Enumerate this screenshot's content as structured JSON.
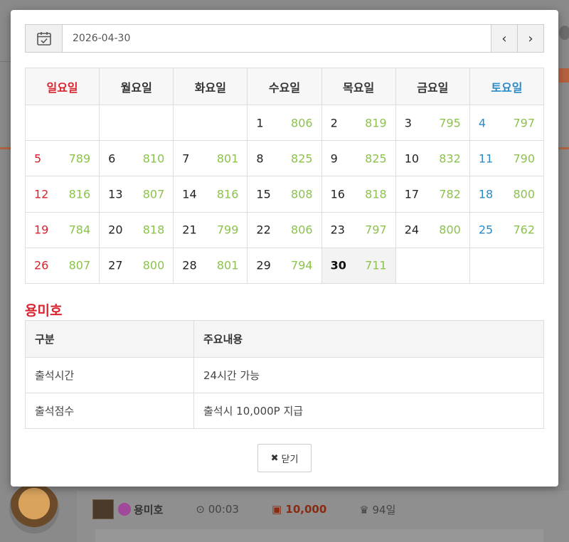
{
  "background": {
    "user_name": "용미호",
    "time": "00:03",
    "points": "10,000",
    "days": "94일"
  },
  "modal": {
    "date_value": "2026-04-30",
    "prev_label": "‹",
    "next_label": "›",
    "weekdays": [
      "일요일",
      "월요일",
      "화요일",
      "수요일",
      "목요일",
      "금요일",
      "토요일"
    ],
    "weeks": [
      [
        null,
        null,
        null,
        {
          "day": "1",
          "count": "806"
        },
        {
          "day": "2",
          "count": "819"
        },
        {
          "day": "3",
          "count": "795"
        },
        {
          "day": "4",
          "count": "797"
        }
      ],
      [
        {
          "day": "5",
          "count": "789"
        },
        {
          "day": "6",
          "count": "810"
        },
        {
          "day": "7",
          "count": "801"
        },
        {
          "day": "8",
          "count": "825"
        },
        {
          "day": "9",
          "count": "825"
        },
        {
          "day": "10",
          "count": "832"
        },
        {
          "day": "11",
          "count": "790"
        }
      ],
      [
        {
          "day": "12",
          "count": "816"
        },
        {
          "day": "13",
          "count": "807"
        },
        {
          "day": "14",
          "count": "816"
        },
        {
          "day": "15",
          "count": "808"
        },
        {
          "day": "16",
          "count": "818"
        },
        {
          "day": "17",
          "count": "782"
        },
        {
          "day": "18",
          "count": "800"
        }
      ],
      [
        {
          "day": "19",
          "count": "784"
        },
        {
          "day": "20",
          "count": "818"
        },
        {
          "day": "21",
          "count": "799"
        },
        {
          "day": "22",
          "count": "806"
        },
        {
          "day": "23",
          "count": "797"
        },
        {
          "day": "24",
          "count": "800"
        },
        {
          "day": "25",
          "count": "762"
        }
      ],
      [
        {
          "day": "26",
          "count": "807"
        },
        {
          "day": "27",
          "count": "800"
        },
        {
          "day": "28",
          "count": "801"
        },
        {
          "day": "29",
          "count": "794"
        },
        {
          "day": "30",
          "count": "711",
          "today": true
        },
        null,
        null
      ]
    ],
    "section_title": "용미호",
    "info_headers": [
      "구분",
      "주요내용"
    ],
    "info_rows": [
      [
        "출석시간",
        "24시간 가능"
      ],
      [
        "출석점수",
        "출석시 10,000P 지급"
      ]
    ],
    "close_label": "닫기",
    "colors": {
      "sunday": "#d9232f",
      "saturday": "#2a8bc8",
      "count": "#8bc34a"
    }
  }
}
